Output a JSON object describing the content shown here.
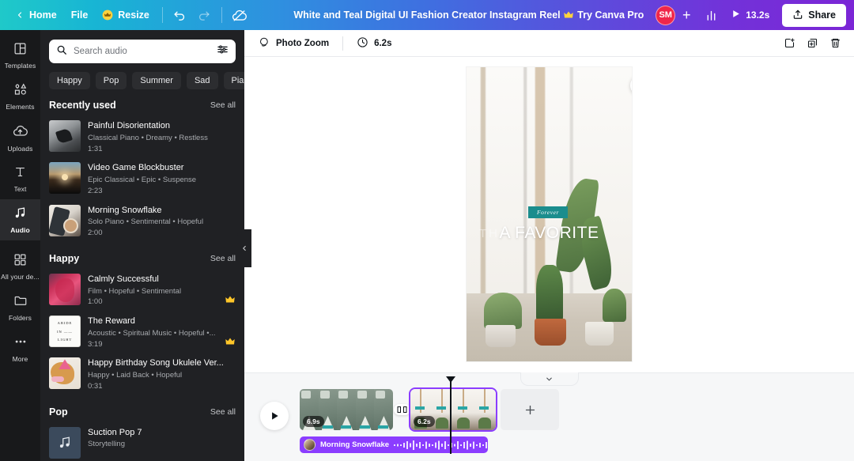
{
  "topbar": {
    "home_label": "Home",
    "file_label": "File",
    "resize_label": "Resize",
    "title": "White and Teal Digital UI Fashion Creator Instagram Reel",
    "try_pro_label": "Try Canva Pro",
    "avatar_initials": "SM",
    "plus_label": "+",
    "duration_label": "13.2s",
    "share_label": "Share",
    "accent_gradient_start": "#1fc9c9",
    "accent_gradient_end": "#7b26d6",
    "avatar_color": "#f0264a"
  },
  "rail": {
    "items": [
      {
        "label": "Templates",
        "icon": "templates-icon",
        "active": false
      },
      {
        "label": "Elements",
        "icon": "elements-icon",
        "active": false
      },
      {
        "label": "Uploads",
        "icon": "uploads-icon",
        "active": false
      },
      {
        "label": "Text",
        "icon": "text-icon",
        "active": false
      },
      {
        "label": "Audio",
        "icon": "audio-icon",
        "active": true
      },
      {
        "label": "All your de...",
        "icon": "all-designs-icon",
        "active": false
      },
      {
        "label": "Folders",
        "icon": "folders-icon",
        "active": false
      },
      {
        "label": "More",
        "icon": "more-icon",
        "active": false
      }
    ]
  },
  "panel": {
    "search_placeholder": "Search audio",
    "search_value": "",
    "filter_icon": "filter-sliders-icon",
    "chips": [
      "Happy",
      "Pop",
      "Summer",
      "Sad",
      "Piano"
    ],
    "see_all_label": "See all",
    "sections": [
      {
        "title": "Recently used",
        "tracks": [
          {
            "name": "Painful Disorientation",
            "meta": "Classical Piano • Dreamy • Restless",
            "duration": "1:31",
            "pro": false
          },
          {
            "name": "Video Game Blockbuster",
            "meta": "Epic Classical • Epic • Suspense",
            "duration": "2:23",
            "pro": false
          },
          {
            "name": "Morning Snowflake",
            "meta": "Solo Piano • Sentimental • Hopeful",
            "duration": "2:00",
            "pro": false
          }
        ]
      },
      {
        "title": "Happy",
        "tracks": [
          {
            "name": "Calmly Successful",
            "meta": "Film • Hopeful • Sentimental",
            "duration": "1:00",
            "pro": true
          },
          {
            "name": "The Reward",
            "meta": "Acoustic • Spiritual Music • Hopeful •...",
            "duration": "3:19",
            "pro": true
          },
          {
            "name": "Happy Birthday Song Ukulele Ver...",
            "meta": "Happy • Laid Back • Hopeful",
            "duration": "0:31",
            "pro": false
          }
        ]
      },
      {
        "title": "Pop",
        "tracks": [
          {
            "name": "Suction Pop 7",
            "meta": "Storytelling",
            "duration": "",
            "pro": false
          }
        ]
      }
    ]
  },
  "context_bar": {
    "photo_zoom_label": "Photo Zoom",
    "photo_zoom_icon": "photo-zoom-icon",
    "clock_icon": "clock-icon",
    "duration_label": "6.2s",
    "actions": [
      {
        "name": "share-page-icon",
        "glyph": "share"
      },
      {
        "name": "duplicate-page-icon",
        "glyph": "duplicate"
      },
      {
        "name": "delete-page-icon",
        "glyph": "trash"
      }
    ]
  },
  "canvas": {
    "magic_icon": "magic-animate-icon",
    "overlay_badge": "Forever",
    "overlay_heading": "A FAVORITE",
    "overlay_ghost": "THE",
    "badge_color": "#1b8d8d"
  },
  "timeline": {
    "collapse_icon": "chevron-down-icon",
    "panel_collapse_icon": "chevron-left-icon",
    "play_icon": "play-icon",
    "clips": [
      {
        "duration": "6.9s",
        "selected": false
      },
      {
        "duration": "6.2s",
        "selected": true
      }
    ],
    "transition_icon": "transition-icon",
    "add_page_label": "+",
    "audio_track": {
      "name": "Morning Snowflake",
      "color": "#8b3dff"
    },
    "playhead_color": "#0e1318"
  }
}
